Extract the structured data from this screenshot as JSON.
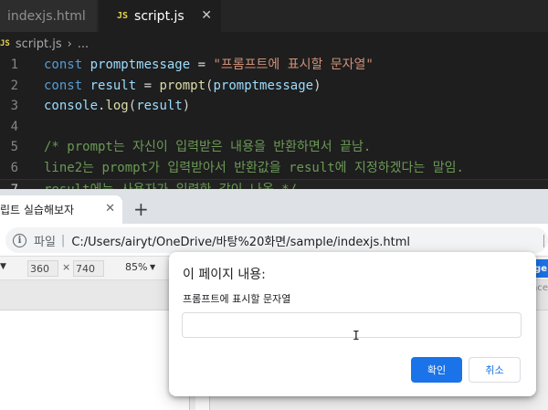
{
  "editor": {
    "tabs": [
      {
        "label": "indexjs.html",
        "active": false
      },
      {
        "label": "script.js",
        "active": true,
        "badge": "JS",
        "close": "✕"
      }
    ],
    "breadcrumb": {
      "badge": "JS",
      "file": "script.js",
      "sep": "›",
      "more": "..."
    },
    "lines": [
      {
        "n": "1",
        "tokens": [
          [
            "kw",
            "const"
          ],
          [
            "pl",
            " "
          ],
          [
            "var",
            "promptmessage"
          ],
          [
            "pl",
            " = "
          ],
          [
            "str",
            "\"프롬프트에 표시할 문자열\""
          ]
        ]
      },
      {
        "n": "2",
        "tokens": [
          [
            "kw",
            "const"
          ],
          [
            "pl",
            " "
          ],
          [
            "var",
            "result"
          ],
          [
            "pl",
            " = "
          ],
          [
            "fn",
            "prompt"
          ],
          [
            "pl",
            "("
          ],
          [
            "var",
            "promptmessage"
          ],
          [
            "pl",
            ")"
          ]
        ]
      },
      {
        "n": "3",
        "tokens": [
          [
            "var",
            "console"
          ],
          [
            "pl",
            "."
          ],
          [
            "fn",
            "log"
          ],
          [
            "pl",
            "("
          ],
          [
            "var",
            "result"
          ],
          [
            "pl",
            ")"
          ]
        ]
      },
      {
        "n": "4",
        "tokens": []
      },
      {
        "n": "5",
        "tokens": [
          [
            "cm",
            "/* prompt는 자신이 입력받은 내용을 반환하면서 끝남."
          ]
        ]
      },
      {
        "n": "6",
        "tokens": [
          [
            "cm",
            "line2는 prompt가 입력받아서 반환값을 result에 지정하겠다는 말임."
          ]
        ]
      },
      {
        "n": "7",
        "tokens": [
          [
            "cm",
            "result에는 사용자가 입력한 값이 나옴.*/"
          ]
        ],
        "current": true
      }
    ]
  },
  "browser": {
    "tab_label": "립트 실습해보자",
    "tab_close": "✕",
    "new_tab": "+",
    "info_icon": "i",
    "url_scheme": "파일",
    "url_divider": "|",
    "url": "C:/Users/airyt/OneDrive/바탕%20화면/sample/indexjs.html",
    "device": {
      "width": "360",
      "times": "×",
      "height": "740",
      "zoom": "85%",
      "right_btn": "ge",
      "side_text": "nce"
    }
  },
  "dialog": {
    "title": "이 페이지 내용:",
    "message": "프롬프트에 표시할 문자열",
    "input_value": "",
    "ok_label": "확인",
    "cancel_label": "취소"
  },
  "colors": {
    "accent": "#1a73e8",
    "editor_bg": "#1e1e1e",
    "keyword": "#569cd6",
    "string": "#ce9178",
    "comment": "#6a9955"
  }
}
